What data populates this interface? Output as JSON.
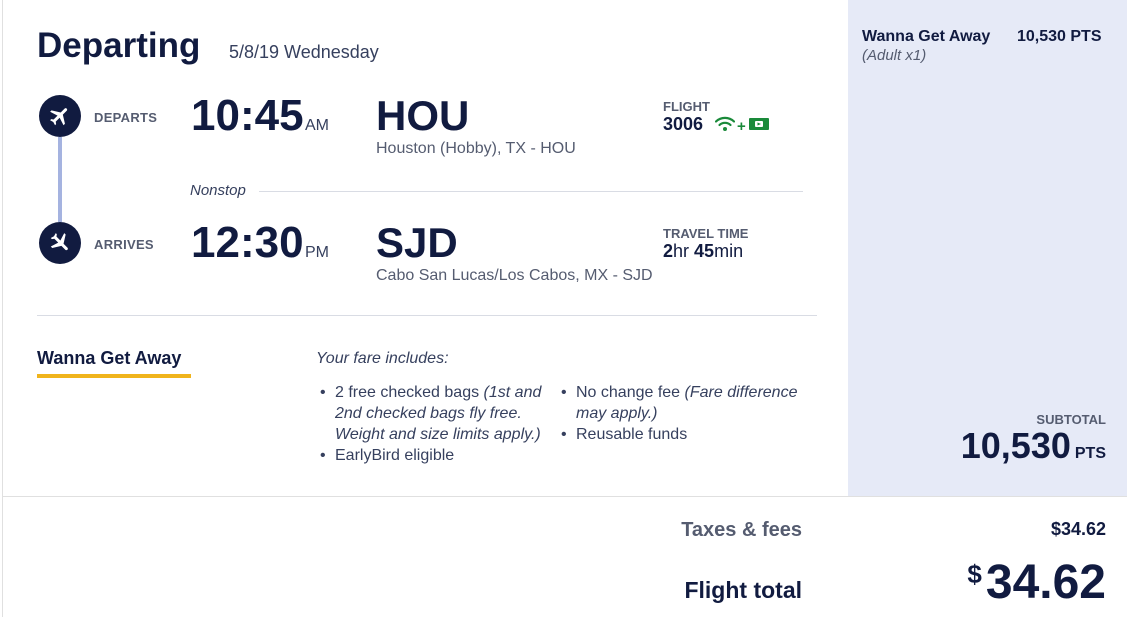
{
  "header": {
    "title": "Departing",
    "date": "5/8/19 Wednesday"
  },
  "departs": {
    "label": "DEPARTS",
    "time": "10:45",
    "ampm": "AM",
    "code": "HOU",
    "city": "Houston (Hobby), TX - HOU",
    "icon": "plane-icon"
  },
  "arrives": {
    "label": "ARRIVES",
    "time": "12:30",
    "ampm": "PM",
    "code": "SJD",
    "city": "Cabo San Lucas/Los Cabos, MX - SJD",
    "icon": "plane-icon"
  },
  "flight": {
    "label": "FLIGHT",
    "number": "3006",
    "amenities": [
      "wifi-icon",
      "plus",
      "tv-icon"
    ],
    "plus": "+"
  },
  "travel": {
    "label": "TRAVEL TIME",
    "hours": "2",
    "hours_unit": "hr",
    "minutes": "45",
    "minutes_unit": "min"
  },
  "nonstop": "Nonstop",
  "fare": {
    "name": "Wanna Get Away",
    "includes_heading": "Your fare includes:",
    "col1": [
      {
        "text": "2 free checked bags ",
        "note": "(1st and 2nd checked bags fly free. Weight and size limits apply.)"
      },
      {
        "text": "EarlyBird eligible",
        "note": ""
      }
    ],
    "col2": [
      {
        "text": "No change fee ",
        "note": "(Fare difference may apply.)"
      },
      {
        "text": "Reusable funds",
        "note": ""
      }
    ]
  },
  "summary": {
    "fare_name": "Wanna Get Away",
    "passengers": "(Adult x1)",
    "points": "10,530 PTS",
    "subtotal_label": "SUBTOTAL",
    "subtotal_value": "10,530",
    "subtotal_unit": "PTS"
  },
  "totals": {
    "taxes_label": "Taxes & fees",
    "taxes_value": "$34.62",
    "total_label": "Flight total",
    "currency": "$",
    "total_value": "34.62"
  },
  "colors": {
    "navy": "#111b40",
    "timeline": "#a5b3e0",
    "fare_underline": "#f0b41c",
    "summary_bg": "#e6eaf7",
    "amenity_green": "#1a8a3a"
  }
}
